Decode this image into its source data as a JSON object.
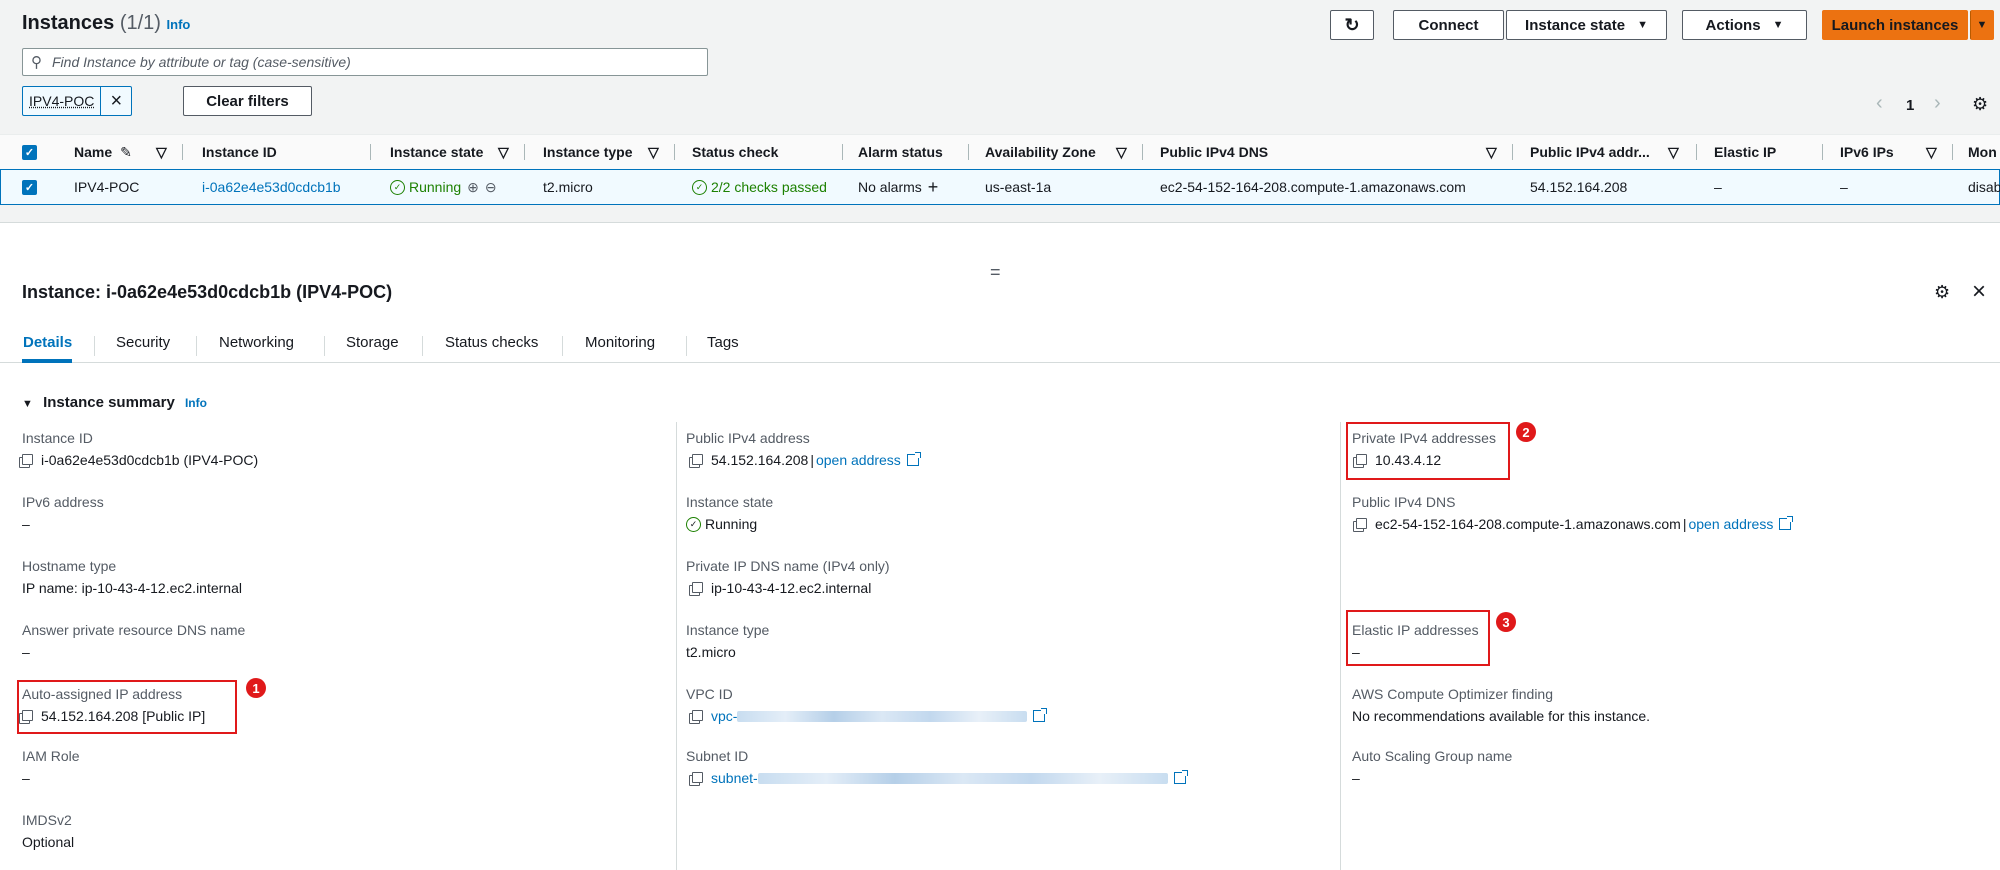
{
  "header": {
    "title": "Instances",
    "count": "(1/1)",
    "info": "Info",
    "buttons": {
      "connect": "Connect",
      "instance_state": "Instance state",
      "actions": "Actions",
      "launch": "Launch instances"
    }
  },
  "search": {
    "placeholder": "Find Instance by attribute or tag (case-sensitive)",
    "value": ""
  },
  "filter": {
    "token": "IPV4-POC",
    "clear": "Clear filters"
  },
  "pagination": {
    "page": "1"
  },
  "table": {
    "columns": [
      "Name",
      "Instance ID",
      "Instance state",
      "Instance type",
      "Status check",
      "Alarm status",
      "Availability Zone",
      "Public IPv4 DNS",
      "Public IPv4 addr...",
      "Elastic IP",
      "IPv6 IPs",
      "Mon"
    ],
    "row": {
      "name": "IPV4-POC",
      "instance_id": "i-0a62e4e53d0cdcb1b",
      "state": "Running",
      "type": "t2.micro",
      "status_check": "2/2 checks passed",
      "alarm": "No alarms",
      "az": "us-east-1a",
      "public_dns": "ec2-54-152-164-208.compute-1.amazonaws.com",
      "public_ip": "54.152.164.208",
      "elastic_ip": "–",
      "ipv6": "–",
      "monitoring": "disab"
    }
  },
  "detail": {
    "title": "Instance: i-0a62e4e53d0cdcb1b (IPV4-POC)",
    "tabs": [
      "Details",
      "Security",
      "Networking",
      "Storage",
      "Status checks",
      "Monitoring",
      "Tags"
    ],
    "summary_title": "Instance summary",
    "info": "Info",
    "open_address": "open address",
    "col1": [
      {
        "label": "Instance ID",
        "value": "i-0a62e4e53d0cdcb1b (IPV4-POC)"
      },
      {
        "label": "IPv6 address",
        "value": "–"
      },
      {
        "label": "Hostname type",
        "value": "IP name: ip-10-43-4-12.ec2.internal"
      },
      {
        "label": "Answer private resource DNS name",
        "value": "–"
      },
      {
        "label": "Auto-assigned IP address",
        "value": "54.152.164.208 [Public IP]"
      },
      {
        "label": "IAM Role",
        "value": "–"
      },
      {
        "label": "IMDSv2",
        "value": "Optional"
      }
    ],
    "col2": [
      {
        "label": "Public IPv4 address",
        "value": "54.152.164.208"
      },
      {
        "label": "Instance state",
        "value": "Running"
      },
      {
        "label": "Private IP DNS name (IPv4 only)",
        "value": "ip-10-43-4-12.ec2.internal"
      },
      {
        "label": "Instance type",
        "value": "t2.micro"
      },
      {
        "label": "VPC ID",
        "value": "vpc-"
      },
      {
        "label": "Subnet ID",
        "value": "subnet-"
      }
    ],
    "col3": [
      {
        "label": "Private IPv4 addresses",
        "value": "10.43.4.12"
      },
      {
        "label": "Public IPv4 DNS",
        "value": "ec2-54-152-164-208.compute-1.amazonaws.com"
      },
      {
        "label": "Elastic IP addresses",
        "value": "–"
      },
      {
        "label": "AWS Compute Optimizer finding",
        "value": "No recommendations available for this instance."
      },
      {
        "label": "Auto Scaling Group name",
        "value": "–"
      }
    ]
  },
  "annotations": [
    "1",
    "2",
    "3"
  ]
}
